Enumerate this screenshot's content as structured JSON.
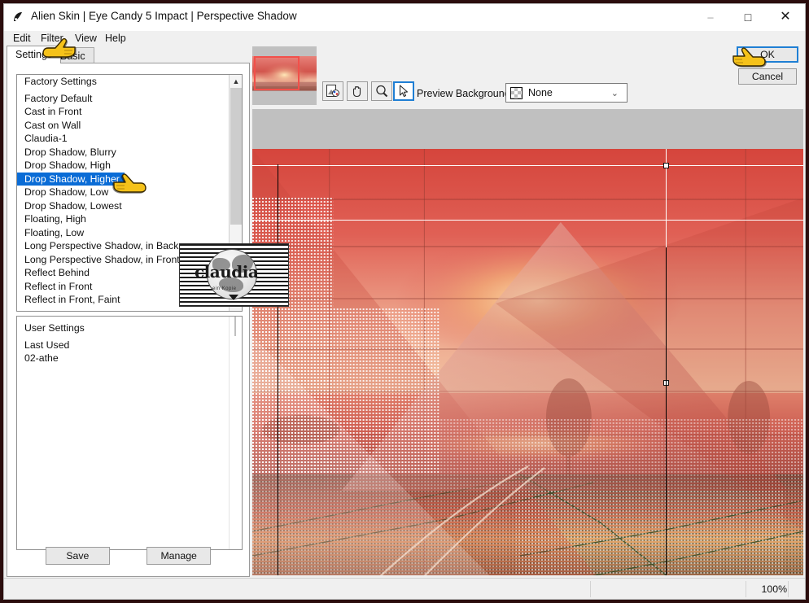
{
  "window": {
    "title": "Alien Skin | Eye Candy 5 Impact | Perspective Shadow",
    "app_icon": "alien-skin-icon",
    "minimize": "–",
    "maximize": "□",
    "close": "✕"
  },
  "menubar": {
    "items": [
      {
        "label": "Edit"
      },
      {
        "label": "Filter"
      },
      {
        "label": "View"
      },
      {
        "label": "Help"
      }
    ]
  },
  "tabs": [
    {
      "label": "Settings",
      "active": true
    },
    {
      "label": "Basic",
      "active": false
    }
  ],
  "settings_panel": {
    "factory_list": {
      "items": [
        "Factory Settings",
        "Factory Default",
        "Cast in Front",
        "Cast on Wall",
        "Claudia-1",
        "Drop Shadow, Blurry",
        "Drop Shadow, High",
        "Drop Shadow, Higher",
        "Drop Shadow, Low",
        "Drop Shadow, Lowest",
        "Floating, High",
        "Floating, Low",
        "Long Perspective Shadow, in Back",
        "Long Perspective Shadow, in Front",
        "Reflect Behind",
        "Reflect in Front",
        "Reflect in Front, Faint"
      ],
      "selected": "Drop Shadow, Higher",
      "selected_index": 7,
      "scroll_up_icon": "chevron-up-icon",
      "scroll_down_icon": "chevron-down-icon"
    },
    "user_list": {
      "items": [
        "User Settings",
        "Last Used",
        "02-athe"
      ]
    },
    "buttons": {
      "save": "Save",
      "manage": "Manage"
    }
  },
  "preview_toolbar": {
    "tools": [
      {
        "name": "preview-toggle",
        "icon": "image-preview-icon",
        "selected": false
      },
      {
        "name": "pan-tool",
        "icon": "hand-icon",
        "selected": false
      },
      {
        "name": "zoom-tool",
        "icon": "magnifier-icon",
        "selected": false
      },
      {
        "name": "select-tool",
        "icon": "arrow-cursor-icon",
        "selected": true
      }
    ],
    "background_label": "Preview Background:",
    "background_value": "None",
    "background_swatch": "checkerboard-swatch",
    "caret_icon": "chevron-down-icon"
  },
  "action_buttons": {
    "ok": "OK",
    "cancel": "Cancel"
  },
  "statusbar": {
    "zoom": "100%"
  },
  "watermark": {
    "text": "claudia",
    "subtext": "ein Kopie"
  },
  "colors": {
    "accent_blue": "#1f7fd4",
    "selection_blue": "#0a6cd6",
    "window_bg": "#f0f0f0",
    "panel_bg": "#ffffff",
    "canvas_bg": "#c0c0c0",
    "frame": "#2b0d0d",
    "thumb_rect": "#f2504a"
  },
  "cursors": [
    {
      "name": "pointing-hand-filter-menu"
    },
    {
      "name": "pointing-hand-list-selection"
    },
    {
      "name": "pointing-hand-ok-button"
    }
  ]
}
